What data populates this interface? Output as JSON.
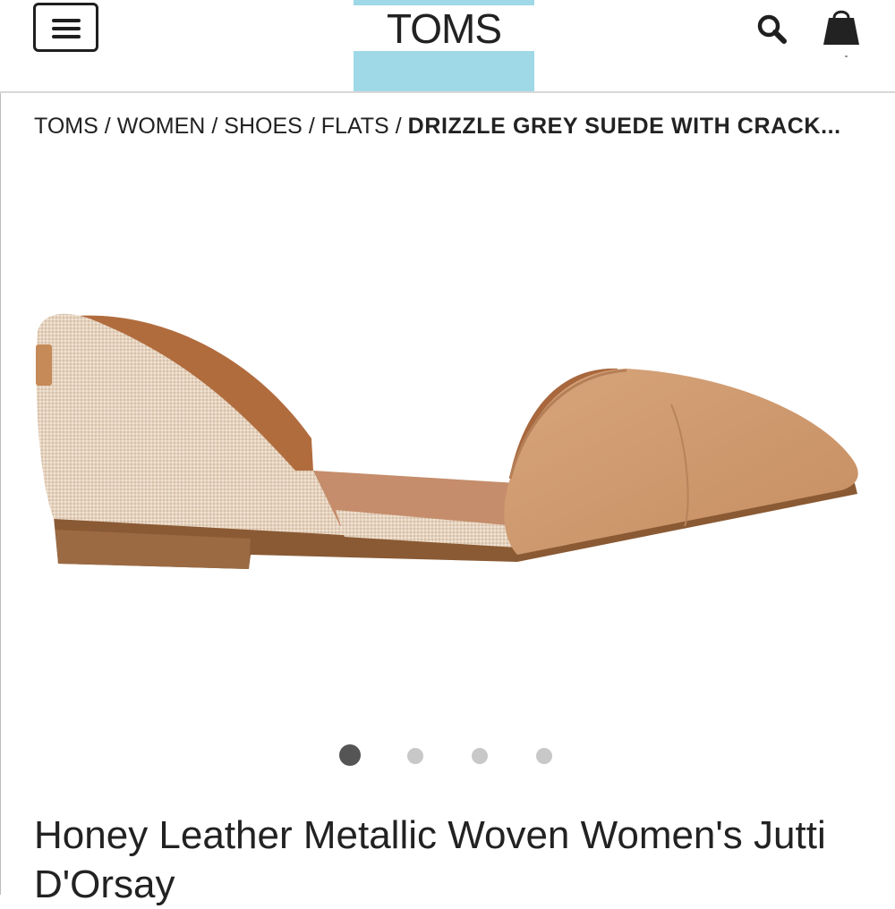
{
  "header": {
    "menu_icon": "hamburger-menu-icon",
    "logo": "TOMS",
    "search_icon": "search-icon",
    "bag_icon": "shopping-bag-icon",
    "brand_color": "#9fd8e6"
  },
  "breadcrumb": {
    "items": [
      "TOMS",
      "WOMEN",
      "SHOES",
      "FLATS"
    ],
    "separator": "/",
    "current": "DRIZZLE GREY SUEDE WITH CRACK..."
  },
  "carousel": {
    "total": 4,
    "active_index": 0
  },
  "product": {
    "title": "Honey Leather Metallic Woven Women's Jutti D'Orsay"
  }
}
